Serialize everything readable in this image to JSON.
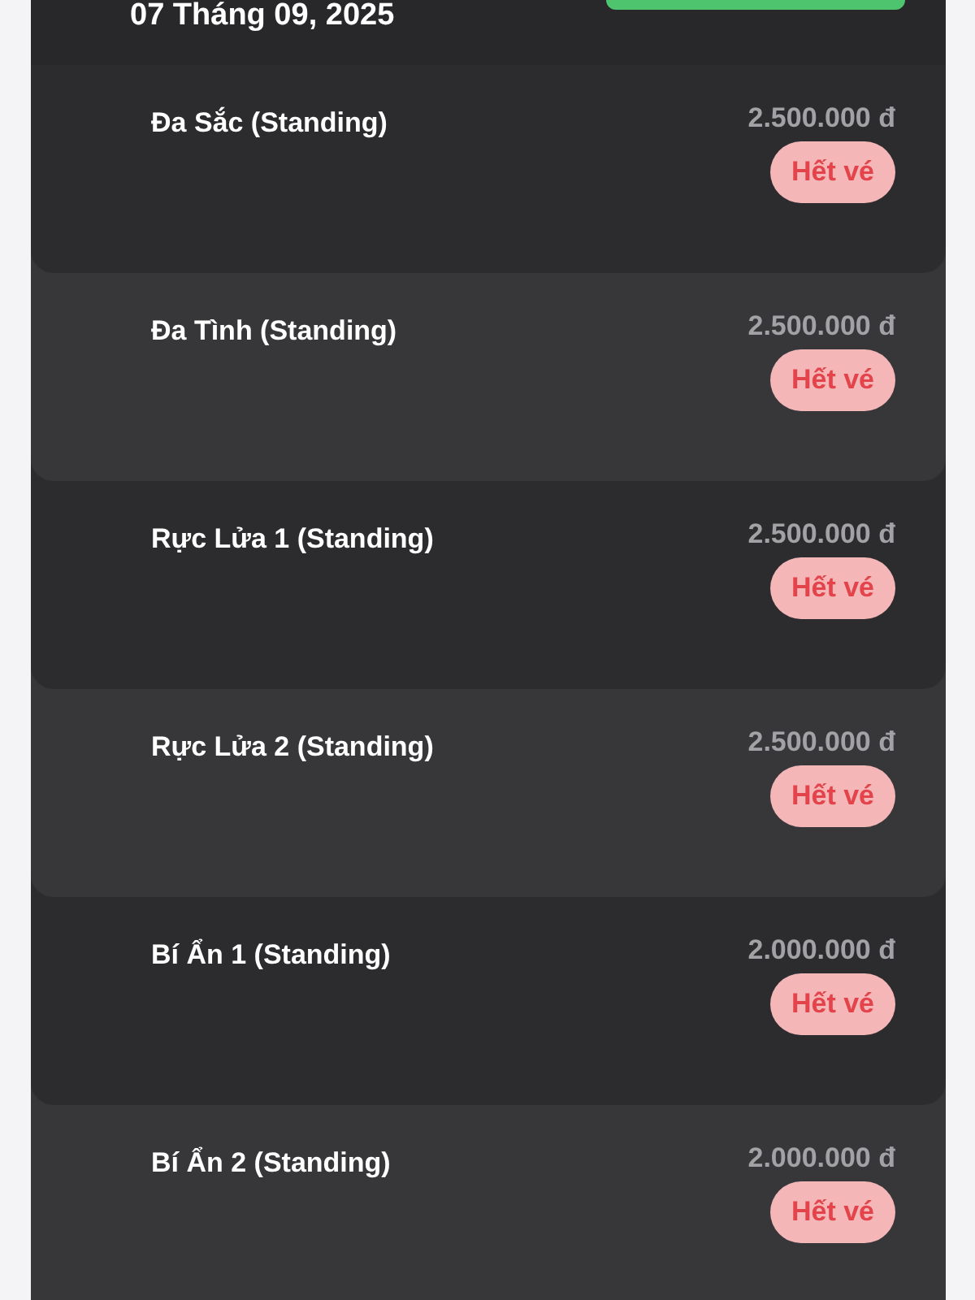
{
  "header": {
    "date": "07 Tháng 09, 2025"
  },
  "tickets": [
    {
      "name": "Đa Sắc (Standing)",
      "price": "2.500.000 đ",
      "status": "Hết vé"
    },
    {
      "name": "Đa Tình (Standing)",
      "price": "2.500.000 đ",
      "status": "Hết vé"
    },
    {
      "name": "Rực Lửa 1 (Standing)",
      "price": "2.500.000 đ",
      "status": "Hết vé"
    },
    {
      "name": "Rực Lửa 2 (Standing)",
      "price": "2.500.000 đ",
      "status": "Hết vé"
    },
    {
      "name": "Bí Ẩn 1 (Standing)",
      "price": "2.000.000 đ",
      "status": "Hết vé"
    },
    {
      "name": "Bí Ẩn 2 (Standing)",
      "price": "2.000.000 đ",
      "status": "Hết vé"
    }
  ]
}
